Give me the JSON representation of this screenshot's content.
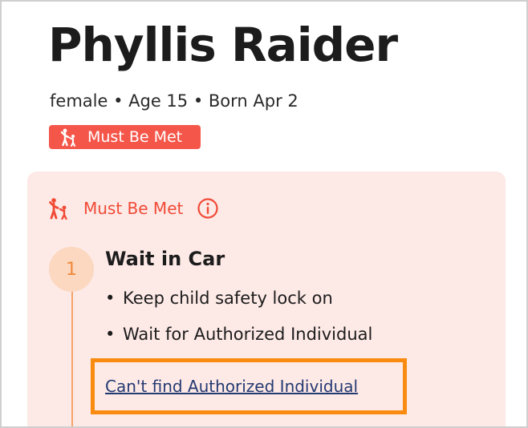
{
  "profile": {
    "name": "Phyllis Raider",
    "meta": "female • Age 15 • Born Apr 2",
    "badge_label": "Must Be Met"
  },
  "panel": {
    "heading": "Must Be Met",
    "step": {
      "number": "1",
      "title": "Wait in Car",
      "bullets": [
        "Keep child safety lock on",
        "Wait for Authorized Individual"
      ],
      "link_label": "Can't find Authorized Individual"
    }
  },
  "colors": {
    "accent_red": "#f5564a",
    "panel_bg": "#fde9e6",
    "step_circle": "#fbd8bf",
    "highlight_orange": "#f98c10",
    "link_blue": "#233a72"
  }
}
